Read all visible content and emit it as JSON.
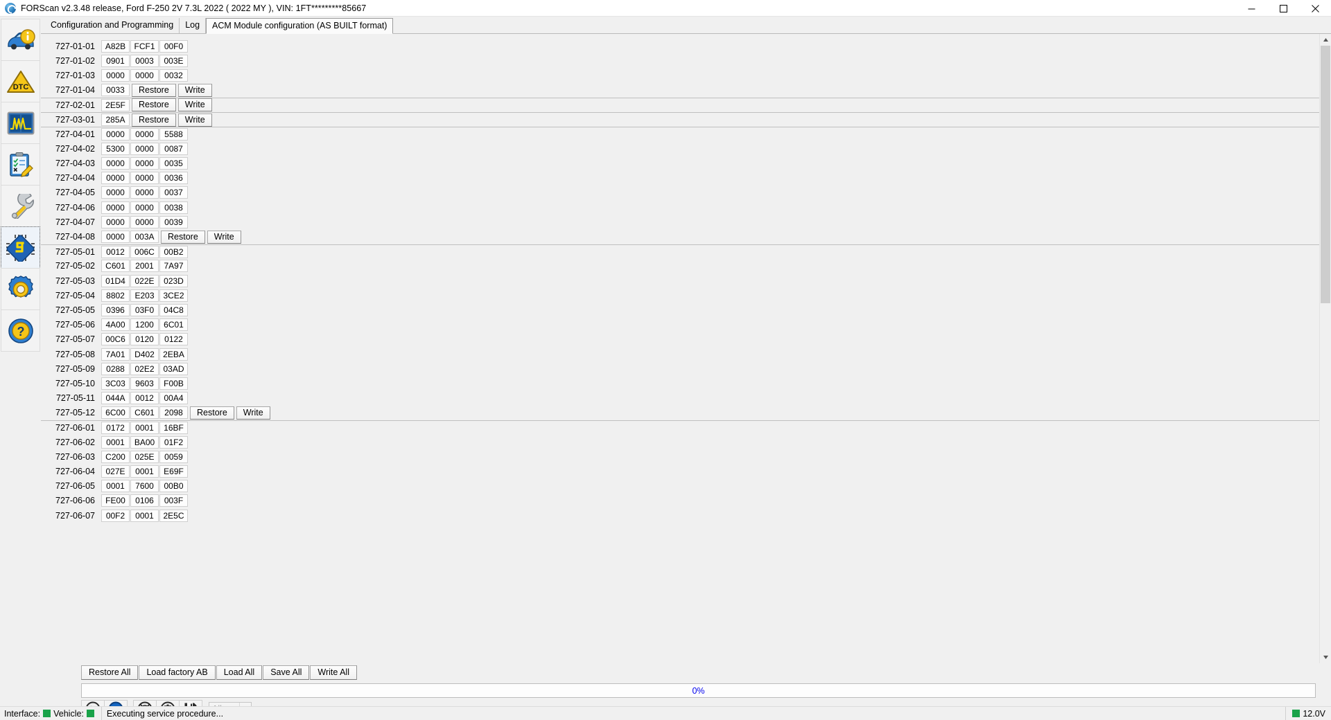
{
  "window": {
    "title": "FORScan v2.3.48 release, Ford F-250 2V 7.3L 2022 ( 2022 MY ), VIN: 1FT*********85667",
    "app_icon": "forscan-logo-icon",
    "minimize_label": "Minimize",
    "maximize_label": "Maximize",
    "close_label": "Close"
  },
  "sidebar": {
    "items": [
      {
        "name": "vehicle-info",
        "icon": "car-info-icon",
        "selected": false
      },
      {
        "name": "dtc",
        "icon": "dtc-warning-icon",
        "selected": false
      },
      {
        "name": "oscilloscope",
        "icon": "oscilloscope-icon",
        "selected": false
      },
      {
        "name": "tests",
        "icon": "test-checklist-icon",
        "selected": false
      },
      {
        "name": "service",
        "icon": "wrench-icon",
        "selected": false
      },
      {
        "name": "configuration",
        "icon": "chip-config-icon",
        "selected": true
      },
      {
        "name": "settings",
        "icon": "gear-icon",
        "selected": false
      },
      {
        "name": "help",
        "icon": "help-question-icon",
        "selected": false
      }
    ]
  },
  "tabs": [
    {
      "label": "Configuration and Programming",
      "active": false
    },
    {
      "label": "Log",
      "active": false
    },
    {
      "label": "ACM Module configuration (AS BUILT format)",
      "active": true
    }
  ],
  "buttons": {
    "restore": "Restore",
    "write": "Write"
  },
  "ab_rows": [
    {
      "label": "727-01-01",
      "values": [
        "A82B",
        "FCF1",
        "00F0"
      ],
      "actions": [],
      "group_start": false
    },
    {
      "label": "727-01-02",
      "values": [
        "0901",
        "0003",
        "003E"
      ],
      "actions": [],
      "group_start": false
    },
    {
      "label": "727-01-03",
      "values": [
        "0000",
        "0000",
        "0032"
      ],
      "actions": [],
      "group_start": false
    },
    {
      "label": "727-01-04",
      "values": [
        "0033"
      ],
      "actions": [
        "Restore",
        "Write"
      ],
      "group_start": false
    },
    {
      "label": "727-02-01",
      "values": [
        "2E5F"
      ],
      "actions": [
        "Restore",
        "Write"
      ],
      "group_start": true
    },
    {
      "label": "727-03-01",
      "values": [
        "285A"
      ],
      "actions": [
        "Restore",
        "Write"
      ],
      "group_start": true
    },
    {
      "label": "727-04-01",
      "values": [
        "0000",
        "0000",
        "5588"
      ],
      "actions": [],
      "group_start": true
    },
    {
      "label": "727-04-02",
      "values": [
        "5300",
        "0000",
        "0087"
      ],
      "actions": [],
      "group_start": false
    },
    {
      "label": "727-04-03",
      "values": [
        "0000",
        "0000",
        "0035"
      ],
      "actions": [],
      "group_start": false
    },
    {
      "label": "727-04-04",
      "values": [
        "0000",
        "0000",
        "0036"
      ],
      "actions": [],
      "group_start": false
    },
    {
      "label": "727-04-05",
      "values": [
        "0000",
        "0000",
        "0037"
      ],
      "actions": [],
      "group_start": false
    },
    {
      "label": "727-04-06",
      "values": [
        "0000",
        "0000",
        "0038"
      ],
      "actions": [],
      "group_start": false
    },
    {
      "label": "727-04-07",
      "values": [
        "0000",
        "0000",
        "0039"
      ],
      "actions": [],
      "group_start": false
    },
    {
      "label": "727-04-08",
      "values": [
        "0000",
        "003A"
      ],
      "actions": [
        "Restore",
        "Write"
      ],
      "group_start": false
    },
    {
      "label": "727-05-01",
      "values": [
        "0012",
        "006C",
        "00B2"
      ],
      "actions": [],
      "group_start": true
    },
    {
      "label": "727-05-02",
      "values": [
        "C601",
        "2001",
        "7A97"
      ],
      "actions": [],
      "group_start": false
    },
    {
      "label": "727-05-03",
      "values": [
        "01D4",
        "022E",
        "023D"
      ],
      "actions": [],
      "group_start": false
    },
    {
      "label": "727-05-04",
      "values": [
        "8802",
        "E203",
        "3CE2"
      ],
      "actions": [],
      "group_start": false
    },
    {
      "label": "727-05-05",
      "values": [
        "0396",
        "03F0",
        "04C8"
      ],
      "actions": [],
      "group_start": false
    },
    {
      "label": "727-05-06",
      "values": [
        "4A00",
        "1200",
        "6C01"
      ],
      "actions": [],
      "group_start": false
    },
    {
      "label": "727-05-07",
      "values": [
        "00C6",
        "0120",
        "0122"
      ],
      "actions": [],
      "group_start": false
    },
    {
      "label": "727-05-08",
      "values": [
        "7A01",
        "D402",
        "2EBA"
      ],
      "actions": [],
      "group_start": false
    },
    {
      "label": "727-05-09",
      "values": [
        "0288",
        "02E2",
        "03AD"
      ],
      "actions": [],
      "group_start": false
    },
    {
      "label": "727-05-10",
      "values": [
        "3C03",
        "9603",
        "F00B"
      ],
      "actions": [],
      "group_start": false
    },
    {
      "label": "727-05-11",
      "values": [
        "044A",
        "0012",
        "00A4"
      ],
      "actions": [],
      "group_start": false
    },
    {
      "label": "727-05-12",
      "values": [
        "6C00",
        "C601",
        "2098"
      ],
      "actions": [
        "Restore",
        "Write"
      ],
      "group_start": false
    },
    {
      "label": "727-06-01",
      "values": [
        "0172",
        "0001",
        "16BF"
      ],
      "actions": [],
      "group_start": true
    },
    {
      "label": "727-06-02",
      "values": [
        "0001",
        "BA00",
        "01F2"
      ],
      "actions": [],
      "group_start": false
    },
    {
      "label": "727-06-03",
      "values": [
        "C200",
        "025E",
        "0059"
      ],
      "actions": [],
      "group_start": false
    },
    {
      "label": "727-06-04",
      "values": [
        "027E",
        "0001",
        "E69F"
      ],
      "actions": [],
      "group_start": false
    },
    {
      "label": "727-06-05",
      "values": [
        "0001",
        "7600",
        "00B0"
      ],
      "actions": [],
      "group_start": false
    },
    {
      "label": "727-06-06",
      "values": [
        "FE00",
        "0106",
        "003F"
      ],
      "actions": [],
      "group_start": false
    },
    {
      "label": "727-06-07",
      "values": [
        "00F2",
        "0001",
        "2E5C"
      ],
      "actions": [],
      "group_start": false
    }
  ],
  "action_bar": [
    "Restore All",
    "Load factory AB",
    "Load All",
    "Save All",
    "Write All"
  ],
  "progress": {
    "percent_label": "0%",
    "value": 0,
    "text_color": "#0000ee"
  },
  "lower_toolbar": {
    "buttons": [
      {
        "name": "play-button",
        "icon": "play-icon"
      },
      {
        "name": "stop-button",
        "icon": "stop-icon"
      },
      {
        "name": "support-button",
        "icon": "lifebuoy-help-icon"
      },
      {
        "name": "clear-button",
        "icon": "trash-icon"
      },
      {
        "name": "save-button",
        "icon": "floppy-save-icon"
      }
    ],
    "filter_combo": {
      "name": "filter-select",
      "value": "All",
      "options": [
        "All"
      ]
    }
  },
  "statusbar": {
    "interface_label": "Interface:",
    "interface_status_color": "#1aa34a",
    "vehicle_label": "Vehicle:",
    "vehicle_status_color": "#1aa34a",
    "message": "Executing service procedure...",
    "voltage": "12.0V",
    "voltage_status_color": "#1aa34a"
  }
}
